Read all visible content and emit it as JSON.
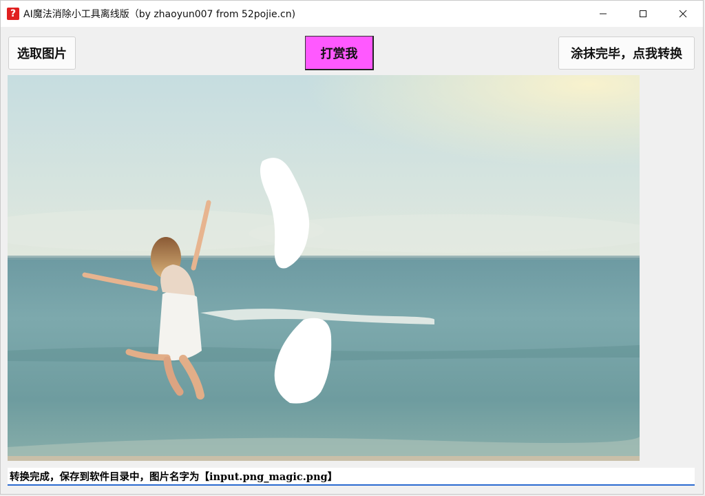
{
  "window": {
    "title": "AI魔法消除小工具离线版（by zhaoyun007 from 52pojie.cn)",
    "icon": "question-mark-app-icon"
  },
  "toolbar": {
    "select_label": "选取图片",
    "reward_label": "打赏我",
    "convert_label": "涂抹完毕，点我转换",
    "reward_color": "#ff59ff"
  },
  "canvas": {
    "description_icon": "photo-canvas"
  },
  "status": {
    "text": "转换完成，保存到软件目录中，图片名字为【input.png_magic.png】"
  }
}
